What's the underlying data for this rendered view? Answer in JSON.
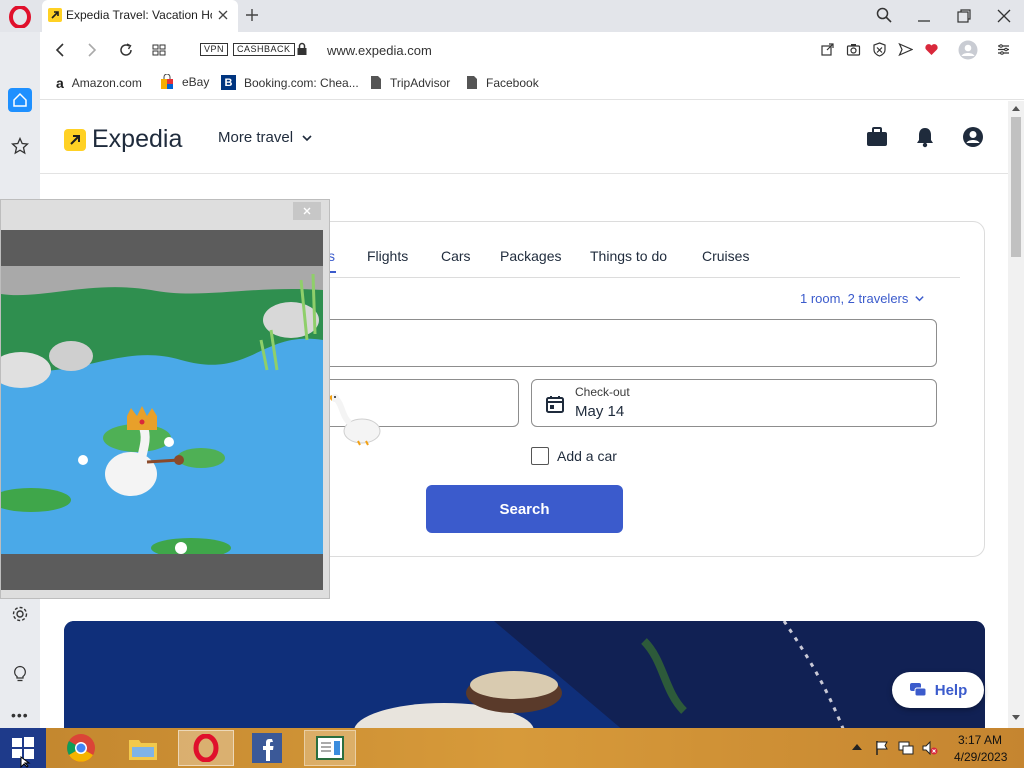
{
  "browser": {
    "tab_title": "Expedia Travel: Vacation Ho",
    "url": "www.expedia.com",
    "vpn_label": "VPN",
    "cashback_label": "CASHBACK",
    "bookmarks": [
      {
        "label": "Amazon.com"
      },
      {
        "label": "eBay"
      },
      {
        "label": "Booking.com: Chea..."
      },
      {
        "label": "TripAdvisor"
      },
      {
        "label": "Facebook"
      }
    ]
  },
  "header": {
    "logo_text": "Expedia",
    "more_travel": "More travel"
  },
  "search": {
    "tabs": [
      "s",
      "Flights",
      "Cars",
      "Packages",
      "Things to do",
      "Cruises"
    ],
    "travelers": "1 room, 2 travelers",
    "checkout_label": "Check-out",
    "checkout_value": "May 14",
    "add_car_label": "Add a car",
    "search_button": "Search"
  },
  "help": {
    "label": "Help"
  },
  "taskbar": {
    "time": "3:17 AM",
    "date": "4/29/2023"
  },
  "colors": {
    "accent": "#3b5bcc",
    "expedia_yellow": "#ffd124",
    "taskbar": "#c98d34"
  }
}
